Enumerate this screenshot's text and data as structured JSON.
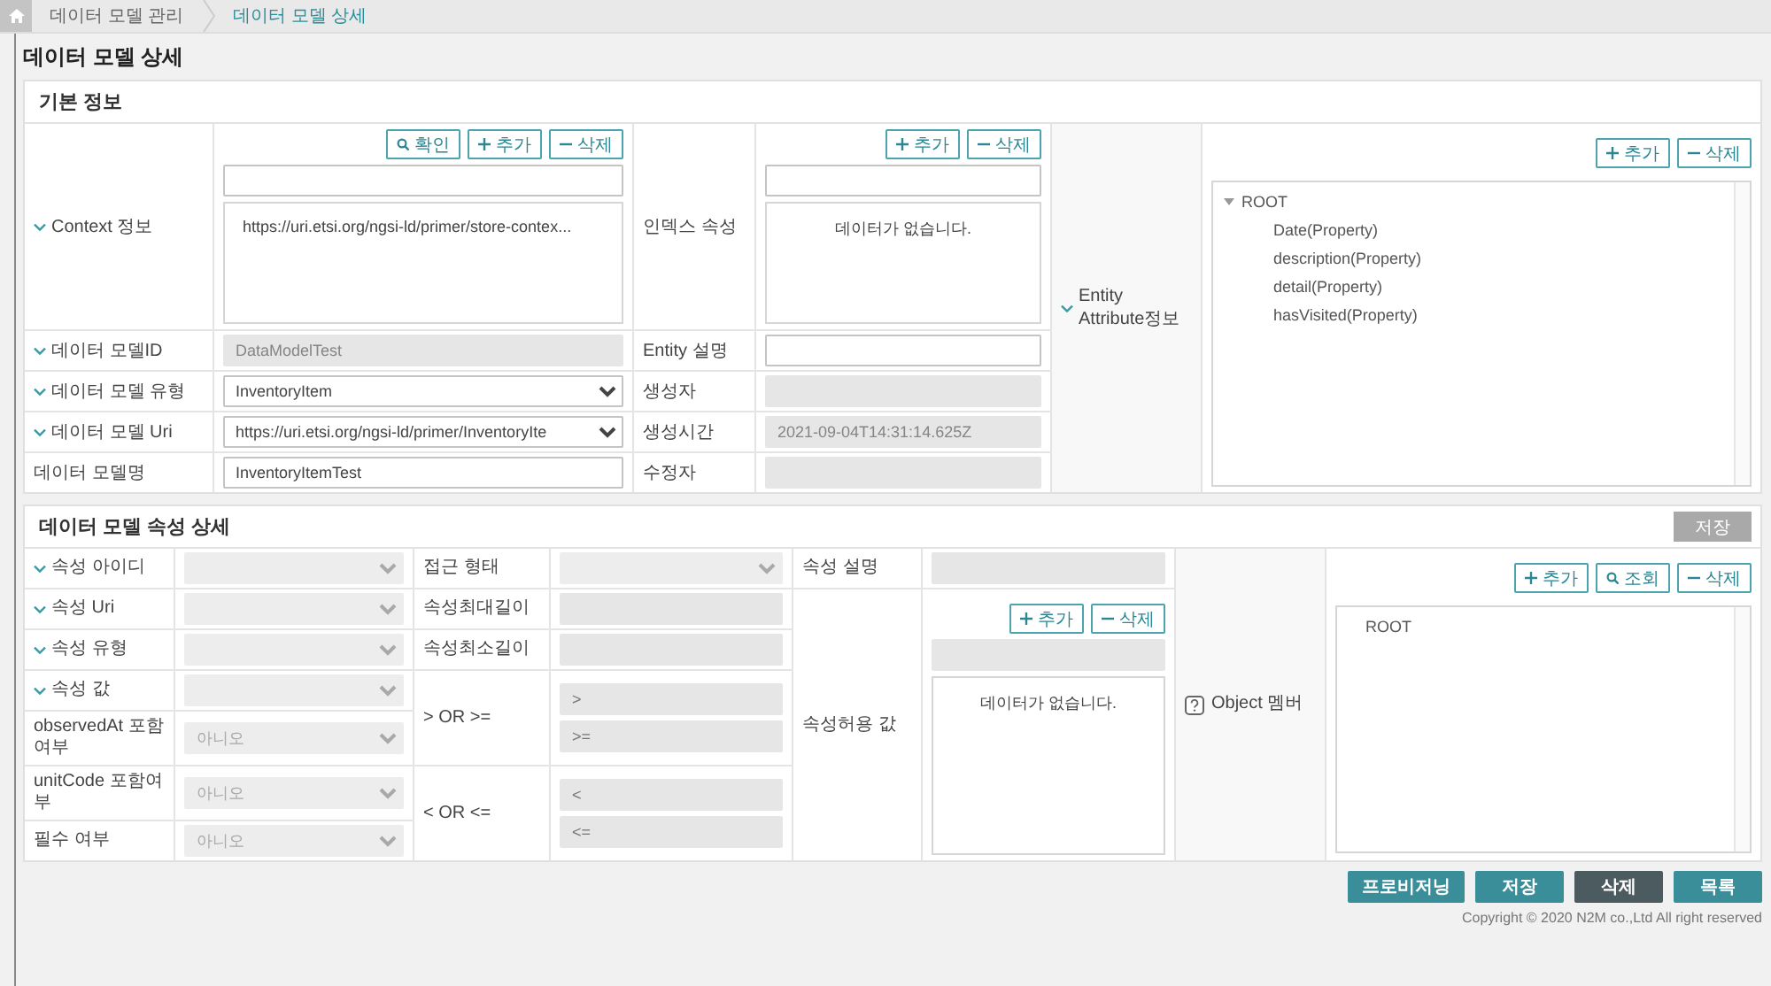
{
  "breadcrumb": {
    "items": [
      {
        "label": "데이터 모델 관리",
        "selected": false
      },
      {
        "label": "데이터 모델 상세",
        "selected": true
      }
    ]
  },
  "page_title": "데이터 모델 상세",
  "basic_info": {
    "title": "기본 정보",
    "context": {
      "label": "Context 정보",
      "expandable": true,
      "buttons": [
        {
          "kind": "search",
          "label": "확인"
        },
        {
          "kind": "add",
          "label": "추가"
        },
        {
          "kind": "remove",
          "label": "삭제"
        }
      ],
      "items": [
        "https://uri.etsi.org/ngsi-ld/primer/store-contex..."
      ]
    },
    "index_attr": {
      "label": "인덱스 속성",
      "buttons": [
        {
          "kind": "add",
          "label": "추가"
        },
        {
          "kind": "remove",
          "label": "삭제"
        }
      ],
      "empty_message": "데이터가 없습니다."
    },
    "entity_attr": {
      "label": "Entity Attribute정보",
      "expandable": true,
      "buttons": [
        {
          "kind": "add",
          "label": "추가"
        },
        {
          "kind": "remove",
          "label": "삭제"
        }
      ],
      "tree": {
        "label": "ROOT",
        "expanded": true,
        "children": [
          {
            "label": "Date(Property)"
          },
          {
            "label": "description(Property)"
          },
          {
            "label": "detail(Property)"
          },
          {
            "label": "hasVisited(Property)"
          }
        ]
      }
    },
    "left_fields": [
      {
        "label": "데이터 모델ID",
        "expandable": true,
        "kind": "input",
        "value": "DataModelTest",
        "disabled": true
      },
      {
        "label": "데이터 모델 유형",
        "expandable": true,
        "kind": "select",
        "value": "InventoryItem",
        "disabled": false
      },
      {
        "label": "데이터 모델 Uri",
        "expandable": true,
        "kind": "select",
        "value": "https://uri.etsi.org/ngsi-ld/primer/InventoryIte",
        "disabled": false
      },
      {
        "label": "데이터 모델명",
        "expandable": false,
        "kind": "input",
        "value": "InventoryItemTest",
        "disabled": false
      }
    ],
    "right_fields": [
      {
        "label": "Entity 설명",
        "kind": "input",
        "disabled": false
      },
      {
        "label": "생성자",
        "kind": "input",
        "disabled": true
      },
      {
        "label": "생성시간",
        "kind": "input",
        "value": "2021-09-04T14:31:14.625Z",
        "disabled": true
      },
      {
        "label": "수정자",
        "kind": "input",
        "disabled": true
      }
    ]
  },
  "attr_detail": {
    "title": "데이터 모델 속성 상세",
    "save_button": {
      "label": "저장",
      "disabled": true
    },
    "left_fields": [
      {
        "label": "속성 아이디",
        "expandable": true,
        "kind": "select",
        "disabled": true
      },
      {
        "label": "속성 Uri",
        "expandable": true,
        "kind": "select",
        "disabled": true
      },
      {
        "label": "속성 유형",
        "expandable": true,
        "kind": "select",
        "disabled": true
      },
      {
        "label": "속성 값",
        "expandable": true,
        "kind": "select",
        "disabled": true
      },
      {
        "label": "observedAt 포함여부",
        "expandable": false,
        "kind": "select",
        "value": "아니오",
        "disabled": true
      },
      {
        "label": "unitCode 포함여부",
        "expandable": false,
        "kind": "select",
        "value": "아니오",
        "disabled": true
      },
      {
        "label": "필수 여부",
        "expandable": false,
        "kind": "select",
        "value": "아니오",
        "disabled": true
      }
    ],
    "middle_fields": [
      {
        "label": "접근 형태",
        "kind": "select",
        "disabled": true
      },
      {
        "label": "속성최대길이",
        "kind": "input",
        "disabled": true
      },
      {
        "label": "속성최소길이",
        "kind": "input",
        "disabled": true
      },
      {
        "label": "> OR >=",
        "kind": "range",
        "inputs": [
          {
            "placeholder": ">"
          },
          {
            "placeholder": ">="
          }
        ]
      },
      {
        "label": "< OR <=",
        "kind": "range",
        "inputs": [
          {
            "placeholder": "<"
          },
          {
            "placeholder": "<="
          }
        ]
      }
    ],
    "description": {
      "label": "속성 설명",
      "disabled": true
    },
    "allowed_values": {
      "label": "속성허용 값",
      "buttons": [
        {
          "kind": "add",
          "label": "추가"
        },
        {
          "kind": "remove",
          "label": "삭제"
        }
      ],
      "input": {
        "disabled": true
      },
      "empty_message": "데이터가 없습니다."
    },
    "object_members": {
      "label": "Object 멤버",
      "buttons": [
        {
          "kind": "add",
          "label": "추가"
        },
        {
          "kind": "search",
          "label": "조회"
        },
        {
          "kind": "remove",
          "label": "삭제"
        }
      ],
      "tree": {
        "label": "ROOT",
        "expanded": false
      }
    }
  },
  "actions": [
    {
      "label": "프로비저닝",
      "kind": "primary"
    },
    {
      "label": "저장",
      "kind": "primary"
    },
    {
      "label": "삭제",
      "kind": "danger"
    },
    {
      "label": "목록",
      "kind": "primary"
    }
  ],
  "copyright": "Copyright © 2020 N2M co.,Ltd All right reserved"
}
